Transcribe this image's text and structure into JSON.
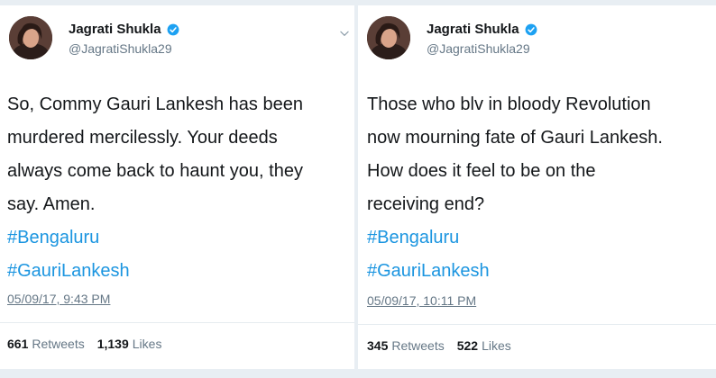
{
  "tweets": [
    {
      "author_name": "Jagrati Shukla",
      "author_handle": "@JagratiShukla29",
      "text": "So, Commy Gauri Lankesh has been\nmurdered mercilessly. Your deeds\nalways come back to haunt you, they\nsay. Amen.",
      "hashtags": [
        "#Bengaluru",
        "#GauriLankesh"
      ],
      "timestamp": "05/09/17, 9:43 PM",
      "retweets_count": "661",
      "retweets_label": "Retweets",
      "likes_count": "1,139",
      "likes_label": "Likes"
    },
    {
      "author_name": "Jagrati Shukla",
      "author_handle": "@JagratiShukla29",
      "text": "Those who blv in bloody Revolution\nnow mourning fate of Gauri Lankesh.\nHow does it feel to be on the\nreceiving end?",
      "hashtags": [
        "#Bengaluru",
        "#GauriLankesh"
      ],
      "timestamp": "05/09/17, 10:11 PM",
      "retweets_count": "345",
      "retweets_label": "Retweets",
      "likes_count": "522",
      "likes_label": "Likes"
    }
  ],
  "colors": {
    "background": "#e8eef3",
    "card": "#ffffff",
    "text": "#14171a",
    "secondary": "#657786",
    "link": "#1b95e0",
    "verified": "#1da1f2"
  },
  "icons": {
    "verified": "verified-badge-icon",
    "menu": "chevron-down-icon"
  }
}
